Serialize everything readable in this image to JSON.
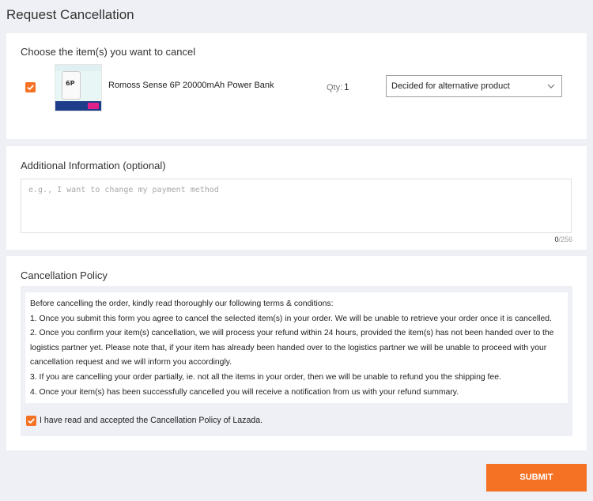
{
  "page": {
    "title": "Request Cancellation"
  },
  "items_section": {
    "title": "Choose the item(s) you want to cancel",
    "items": [
      {
        "checked": true,
        "image_icon": "power-bank-product-image",
        "image_text": "6P",
        "name": "Romoss Sense 6P 20000mAh Power Bank",
        "qty_label": "Qty:",
        "qty_value": "1",
        "reason": "Decided for alternative product"
      }
    ]
  },
  "info_section": {
    "title": "Additional Information (optional)",
    "placeholder": "e.g., I want to change my payment method",
    "value": "",
    "char_count": "0",
    "char_max": "/256"
  },
  "policy_section": {
    "title": "Cancellation Policy",
    "lines": [
      "Before cancelling the order, kindly read thoroughly our following terms & conditions:",
      "1. Once you submit this form you agree to cancel the selected item(s) in your order. We will be unable to retrieve your order once it is cancelled.",
      "2. Once you confirm your item(s) cancellation, we will process your refund within 24 hours, provided the item(s) has not been handed over to the logistics partner yet. Please note that, if your item has already been handed over to the logistics partner we will be unable to proceed with your cancellation request and we will inform you accordingly.",
      "3. If you are cancelling your order partially, ie. not all the items in your order, then we will be unable to refund you the shipping fee.",
      "4. Once your item(s) has been successfully cancelled you will receive a notification from us with your refund summary."
    ],
    "accept_checked": true,
    "accept_label": "I have read and accepted the Cancellation Policy of Lazada."
  },
  "submit_label": "SUBMIT",
  "colors": {
    "accent": "#f57224",
    "background": "#eff0f5"
  },
  "icons": {
    "checkbox": "checkmark-icon",
    "dropdown": "chevron-down-icon"
  }
}
